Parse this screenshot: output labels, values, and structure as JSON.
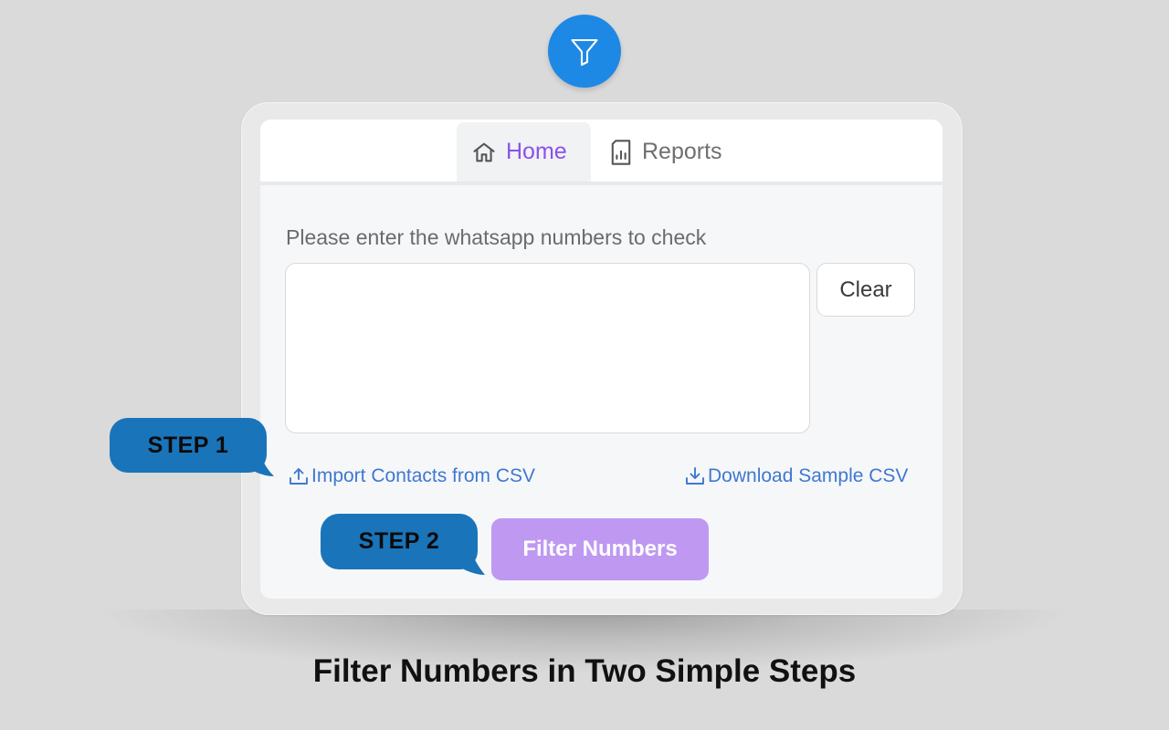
{
  "tabs": [
    {
      "label": "Home",
      "icon": "home-icon",
      "active": true
    },
    {
      "label": "Reports",
      "icon": "report-icon",
      "active": false
    }
  ],
  "form": {
    "prompt": "Please enter the whatsapp numbers to check",
    "numbers_value": "",
    "clear_label": "Clear",
    "import_label": "Import Contacts from CSV",
    "download_label": "Download Sample CSV",
    "filter_label": "Filter Numbers"
  },
  "steps": {
    "step1": "STEP 1",
    "step2": "STEP 2"
  },
  "caption": "Filter Numbers in Two Simple Steps",
  "colors": {
    "accent_purple": "#8a52e8",
    "button_purple": "#bf98f2",
    "link_blue": "#3f78d1",
    "logo_blue": "#1e88e5",
    "bubble_blue": "#1a74b9"
  }
}
